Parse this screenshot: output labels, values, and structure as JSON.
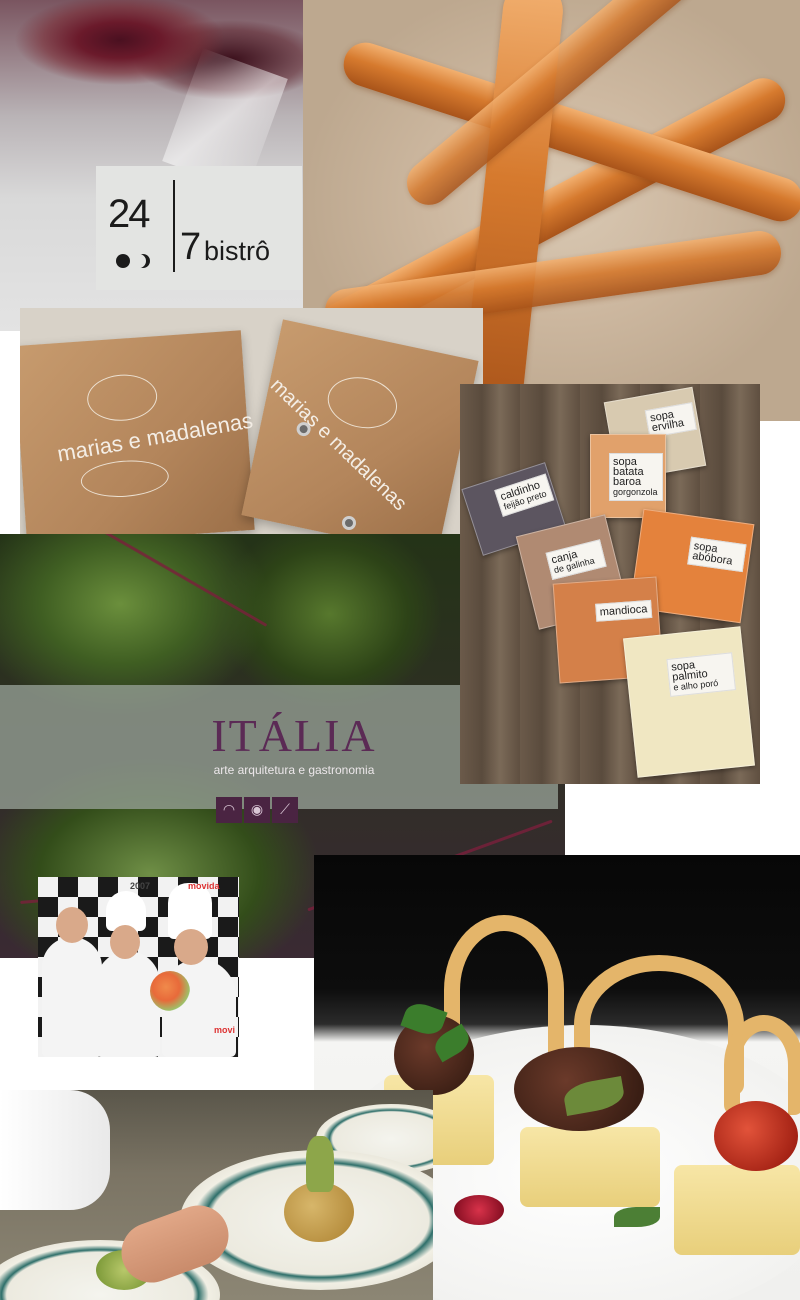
{
  "bistro_logo": {
    "number": "24",
    "seven": "7",
    "name": "bistrô"
  },
  "marias": {
    "brand_left": "marias e madalenas",
    "brand_right": "marias e madalenas"
  },
  "soups": [
    {
      "name": "caldinho",
      "sub": "feijão preto"
    },
    {
      "name": "sopa ervilha",
      "sub": ""
    },
    {
      "name": "sopa batata baroa",
      "sub": "gorgonzola"
    },
    {
      "name": "canja",
      "sub": "de galinha"
    },
    {
      "name": "sopa abóbora",
      "sub": ""
    },
    {
      "name": "mandioca",
      "sub": ""
    },
    {
      "name": "sopa palmito",
      "sub": "e alho poró"
    }
  ],
  "italia": {
    "title": "ITÁLIA",
    "subtitle": "arte arquitetura e gastronomia",
    "icons": [
      "leaf-icon",
      "leaf-icon",
      "feather-icon"
    ]
  },
  "chefs_photo": {
    "sponsors": [
      "movida",
      "2007",
      "movi"
    ]
  },
  "colors": {
    "italia_purple": "#5b2a55",
    "churro_orange": "#d67a2e",
    "kraft": "#b3855b"
  }
}
